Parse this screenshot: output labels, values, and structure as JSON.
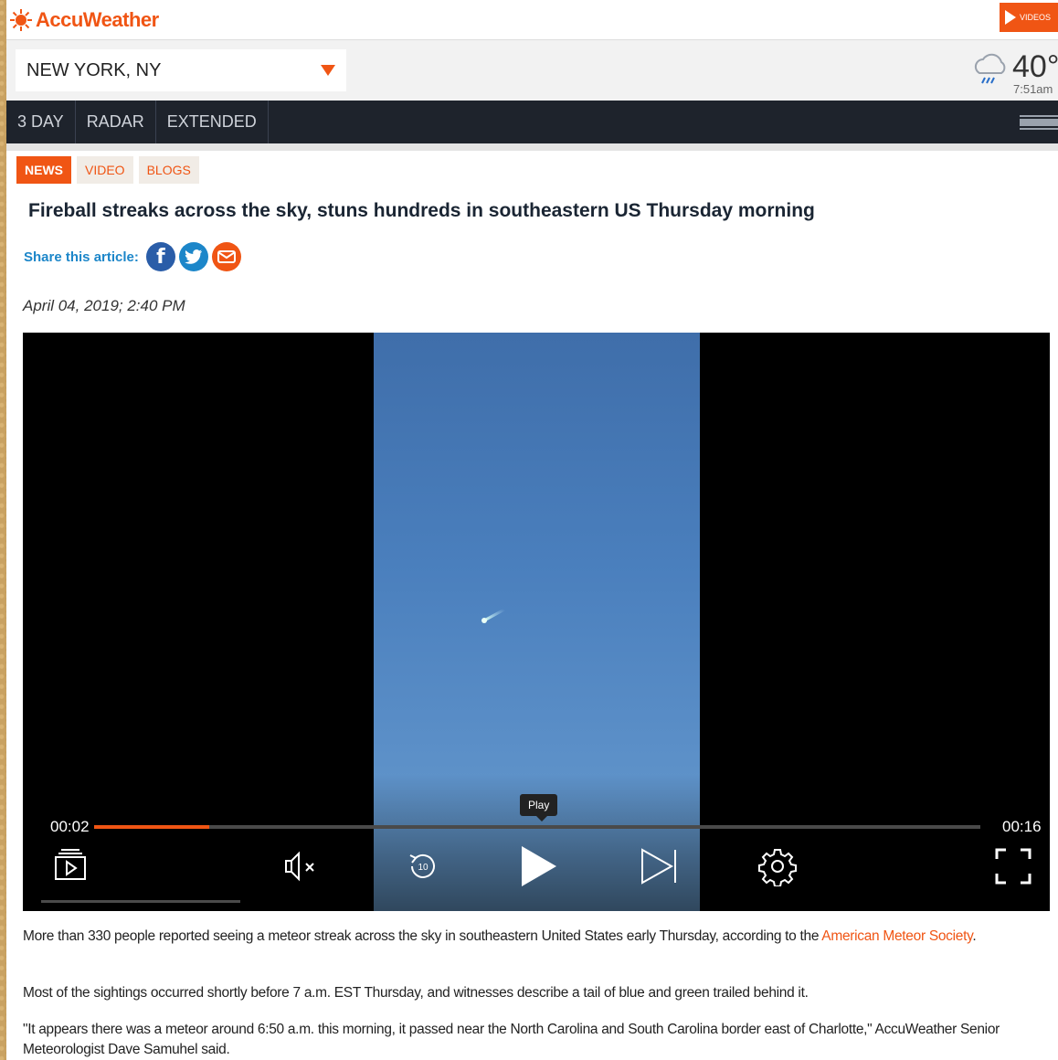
{
  "header": {
    "logo_text": "AccuWeather",
    "videos_label": "VIDEOS",
    "brand_color": "#f05514"
  },
  "location": {
    "name": "NEW YORK, NY",
    "temperature": "40°",
    "time": "7:51am",
    "weather_icon": "cloud-rain-icon"
  },
  "nav": {
    "items": [
      "3 DAY",
      "RADAR",
      "EXTENDED"
    ],
    "menu_label": "Menu"
  },
  "tabs": [
    {
      "label": "NEWS",
      "active": true
    },
    {
      "label": "VIDEO",
      "active": false
    },
    {
      "label": "BLOGS",
      "active": false
    }
  ],
  "article": {
    "headline": "Fireball streaks across the sky, stuns hundreds in southeastern US Thursday morning",
    "share_label": "Share this article:",
    "date": "April 04, 2019; 2:40 PM",
    "paragraphs": {
      "p1_text": "More than 330 people reported seeing a meteor streak across the sky in southeastern United States early Thursday, according to the ",
      "p1_link": "American Meteor Society",
      "p1_end": ".",
      "p2": "Most of the sightings occurred shortly before 7 a.m. EST Thursday, and witnesses describe a tail of blue and green trailed behind it.",
      "p3": "\"It appears there was a meteor around 6:50 a.m. this morning, it passed near the North Carolina and South Carolina border east of Charlotte,\" AccuWeather Senior Meteorologist Dave Samuhel said."
    }
  },
  "video": {
    "current_time": "00:02",
    "duration": "00:16",
    "progress_fraction": 0.13,
    "tooltip": "Play"
  }
}
